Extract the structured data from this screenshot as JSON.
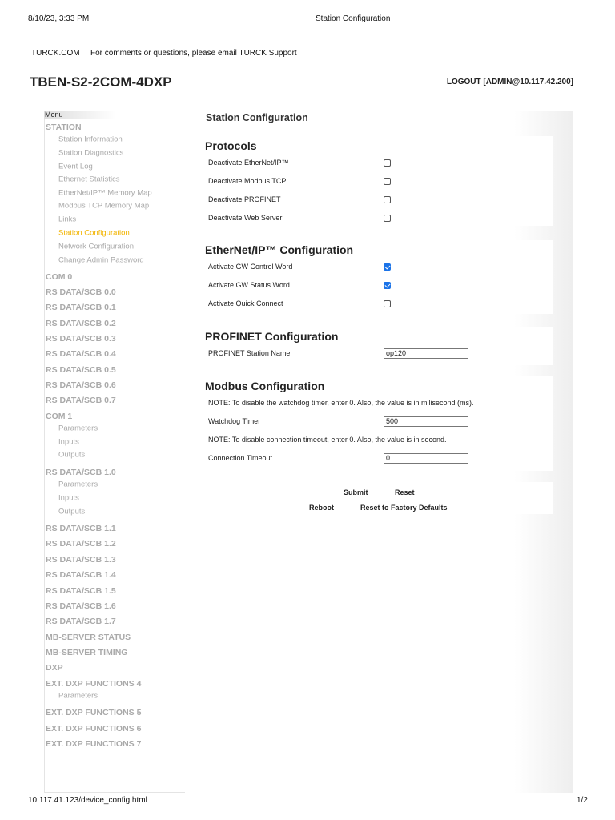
{
  "print_header": {
    "datetime": "8/10/23, 3:33 PM",
    "title": "Station Configuration"
  },
  "print_footer": {
    "url": "10.117.41.123/device_config.html",
    "page": "1/2"
  },
  "topbar": {
    "turck_link": "TURCK.COM",
    "support_text": "For comments or questions, please email TURCK Support"
  },
  "device_title": "TBEN-S2-2COM-4DXP",
  "logout": "LOGOUT [ADMIN@10.117.42.200]",
  "sidebar": {
    "menu_label": "Menu",
    "items": [
      {
        "label": "STATION",
        "level": "main"
      },
      {
        "label": "Station Information",
        "level": "sub"
      },
      {
        "label": "Station Diagnostics",
        "level": "sub"
      },
      {
        "label": "Event Log",
        "level": "sub"
      },
      {
        "label": "Ethernet Statistics",
        "level": "sub"
      },
      {
        "label": "EtherNet/IP™ Memory Map",
        "level": "sub"
      },
      {
        "label": "Modbus TCP Memory Map",
        "level": "sub"
      },
      {
        "label": "Links",
        "level": "sub"
      },
      {
        "label": "Station Configuration",
        "level": "sub",
        "active": true
      },
      {
        "label": "Network Configuration",
        "level": "sub"
      },
      {
        "label": "Change Admin Password",
        "level": "sub"
      },
      {
        "label": "COM 0",
        "level": "main"
      },
      {
        "label": "RS DATA/SCB 0.0",
        "level": "main"
      },
      {
        "label": "RS DATA/SCB 0.1",
        "level": "main"
      },
      {
        "label": "RS DATA/SCB 0.2",
        "level": "main"
      },
      {
        "label": "RS DATA/SCB 0.3",
        "level": "main"
      },
      {
        "label": "RS DATA/SCB 0.4",
        "level": "main"
      },
      {
        "label": "RS DATA/SCB 0.5",
        "level": "main"
      },
      {
        "label": "RS DATA/SCB 0.6",
        "level": "main"
      },
      {
        "label": "RS DATA/SCB 0.7",
        "level": "main"
      },
      {
        "label": "COM 1",
        "level": "main"
      },
      {
        "label": "Parameters",
        "level": "sub"
      },
      {
        "label": "Inputs",
        "level": "sub"
      },
      {
        "label": "Outputs",
        "level": "sub"
      },
      {
        "label": "RS DATA/SCB 1.0",
        "level": "main"
      },
      {
        "label": "Parameters",
        "level": "sub"
      },
      {
        "label": "Inputs",
        "level": "sub"
      },
      {
        "label": "Outputs",
        "level": "sub"
      },
      {
        "label": "RS DATA/SCB 1.1",
        "level": "main"
      },
      {
        "label": "RS DATA/SCB 1.2",
        "level": "main"
      },
      {
        "label": "RS DATA/SCB 1.3",
        "level": "main"
      },
      {
        "label": "RS DATA/SCB 1.4",
        "level": "main"
      },
      {
        "label": "RS DATA/SCB 1.5",
        "level": "main"
      },
      {
        "label": "RS DATA/SCB 1.6",
        "level": "main"
      },
      {
        "label": "RS DATA/SCB 1.7",
        "level": "main"
      },
      {
        "label": "MB-SERVER STATUS",
        "level": "main"
      },
      {
        "label": "MB-SERVER TIMING",
        "level": "main"
      },
      {
        "label": "DXP",
        "level": "main"
      },
      {
        "label": "EXT. DXP FUNCTIONS 4",
        "level": "main"
      },
      {
        "label": "Parameters",
        "level": "sub"
      },
      {
        "label": "EXT. DXP FUNCTIONS 5",
        "level": "main"
      },
      {
        "label": "EXT. DXP FUNCTIONS 6",
        "level": "main"
      },
      {
        "label": "EXT. DXP FUNCTIONS 7",
        "level": "main"
      }
    ]
  },
  "main": {
    "title": "Station Configuration",
    "protocols": {
      "heading": "Protocols",
      "rows": [
        {
          "label": "Deactivate EtherNet/IP™",
          "checked": false
        },
        {
          "label": "Deactivate Modbus TCP",
          "checked": false
        },
        {
          "label": "Deactivate PROFINET",
          "checked": false
        },
        {
          "label": "Deactivate Web Server",
          "checked": false
        }
      ]
    },
    "ethernetip": {
      "heading": "EtherNet/IP™ Configuration",
      "rows": [
        {
          "label": "Activate GW Control Word",
          "checked": true
        },
        {
          "label": "Activate GW Status Word",
          "checked": true
        },
        {
          "label": "Activate Quick Connect",
          "checked": false
        }
      ]
    },
    "profinet": {
      "heading": "PROFINET Configuration",
      "station_name_label": "PROFINET Station Name",
      "station_name_value": "op120"
    },
    "modbus": {
      "heading": "Modbus Configuration",
      "note_watchdog": "NOTE: To disable the watchdog timer, enter 0. Also, the value is in milisecond (ms).",
      "watchdog_label": "Watchdog Timer",
      "watchdog_value": "500",
      "note_timeout": "NOTE: To disable connection timeout, enter 0. Also, the value is in second.",
      "timeout_label": "Connection Timeout",
      "timeout_value": "0"
    },
    "buttons": {
      "submit": "Submit",
      "reset": "Reset",
      "reboot": "Reboot",
      "factory": "Reset to Factory Defaults"
    }
  }
}
